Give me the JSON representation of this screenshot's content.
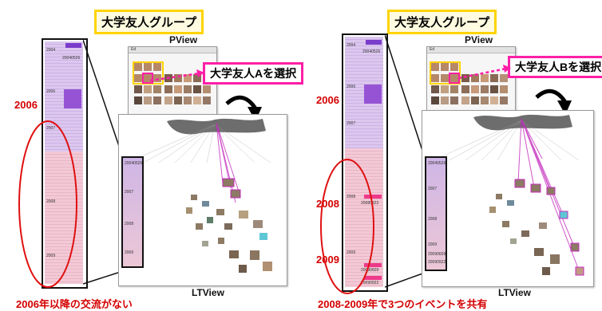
{
  "left_panel": {
    "group_label": "大学友人グループ",
    "pview_label": "PView",
    "select_label": "大学友人Aを選択",
    "year_label": "2006",
    "ltview_label": "LTView",
    "caption": "2006年以降の交流がない",
    "timeline": {
      "labels": [
        "2004",
        "20040526",
        "2006",
        "2007",
        "2008",
        "2009"
      ]
    },
    "mini_labels": [
      "20040526",
      "2007",
      "2008",
      "2009"
    ]
  },
  "right_panel": {
    "group_label": "大学友人グループ",
    "pview_label": "PView",
    "select_label": "大学友人Bを選択",
    "year_labels": [
      "2006",
      "2008",
      "2009"
    ],
    "ltview_label": "LTView",
    "caption": "2008-2009年で3つのイベントを共有",
    "timeline": {
      "labels": [
        "2004",
        "20040526",
        "2006",
        "2007",
        "2008",
        "20080322",
        "2009",
        "20090609",
        "20090922"
      ]
    },
    "mini_labels": [
      "20040526",
      "2007",
      "2008",
      "2009",
      "20090609",
      "20090922"
    ]
  },
  "colors": {
    "highlight_yellow": "#ffd400",
    "highlight_magenta": "#ff1fa6",
    "annotation_red": "#d40000",
    "link_purple": "#c42bbd"
  }
}
